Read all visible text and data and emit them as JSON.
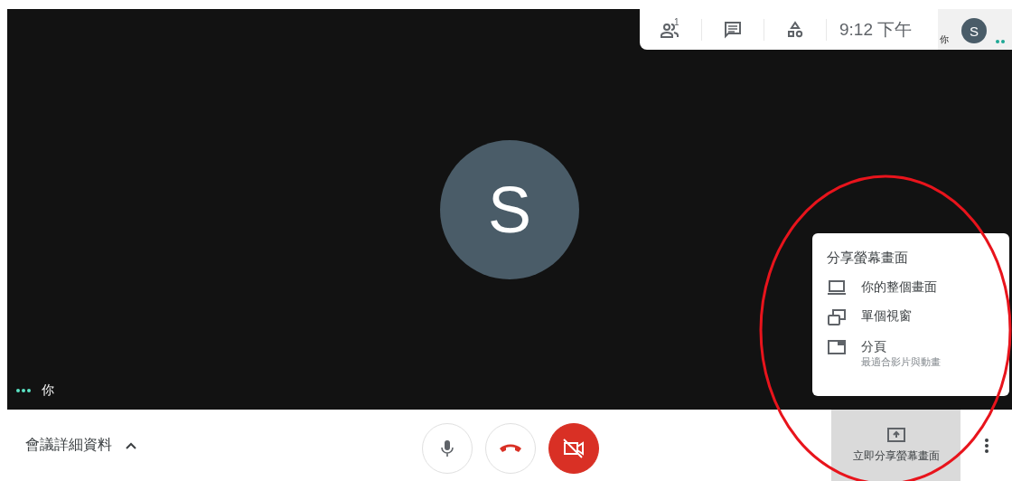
{
  "top_bar": {
    "participant_count": "1",
    "time": "9:12 下午",
    "self_tile": {
      "label": "你",
      "avatar_initial": "S",
      "speaking": true
    }
  },
  "stage": {
    "avatar_initial": "S",
    "self_label": "你",
    "speaking": true
  },
  "share_menu": {
    "title": "分享螢幕畫面",
    "items": [
      {
        "kind": "screen",
        "label": "你的整個畫面"
      },
      {
        "kind": "window",
        "label": "單個視窗"
      },
      {
        "kind": "tab",
        "label": "分頁",
        "hint": "最適合影片與動畫"
      }
    ]
  },
  "bottom_bar": {
    "meeting_details": "會議詳細資料",
    "mic_on": true,
    "camera_on": false,
    "share_button": "立即分享螢幕畫面"
  }
}
